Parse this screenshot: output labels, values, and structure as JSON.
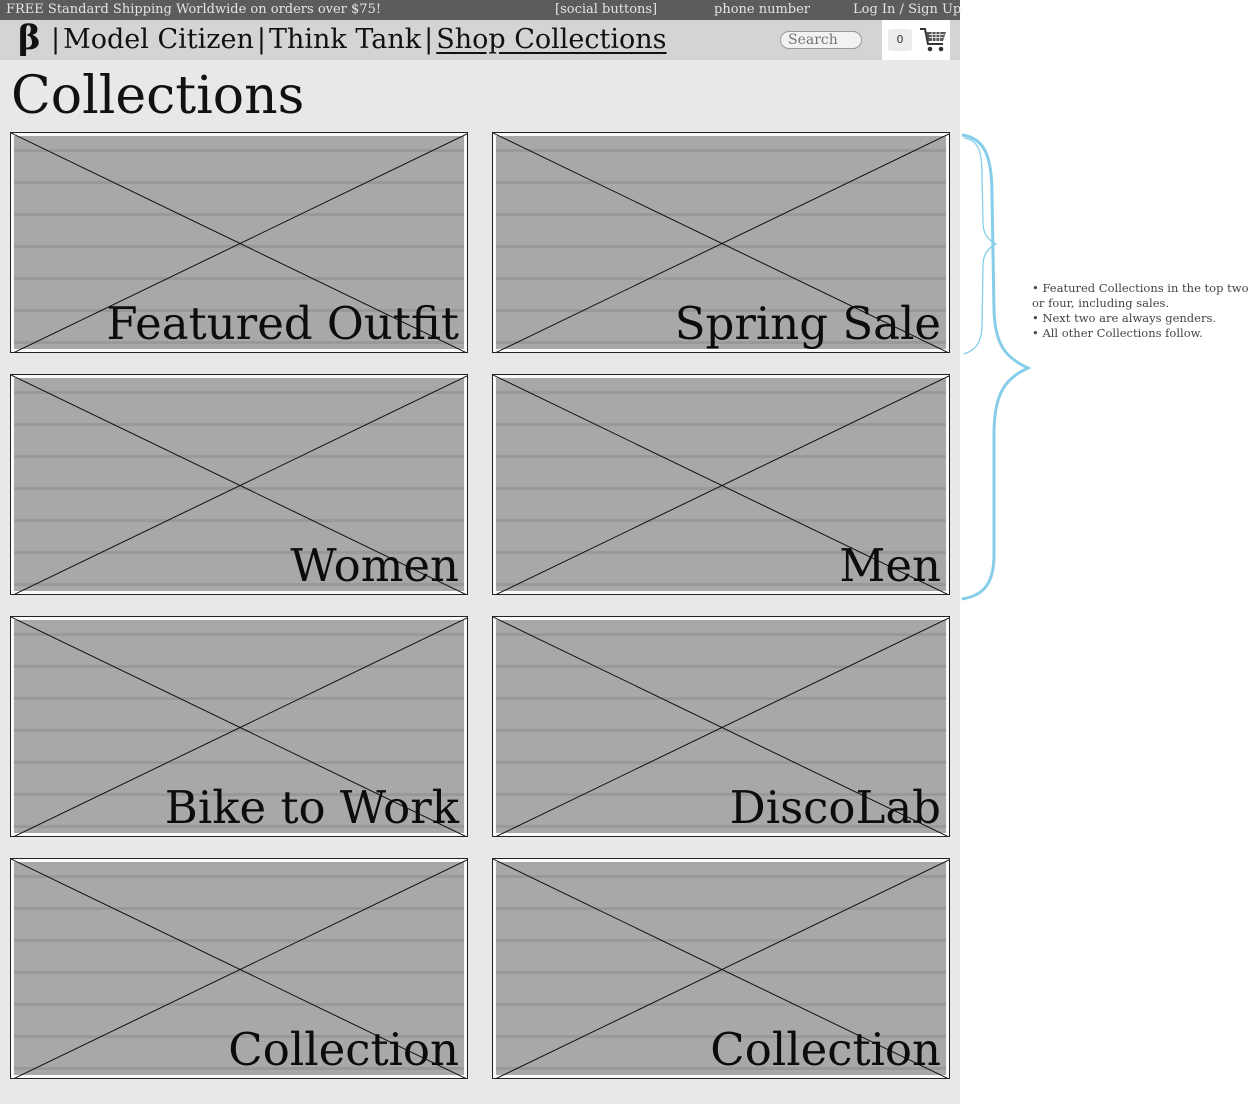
{
  "topbar": {
    "promo": "FREE Standard Shipping Worldwide on orders over $75!",
    "social": "[social buttons]",
    "phone": "phone number",
    "auth": "Log In / Sign Up"
  },
  "nav": {
    "logo": "β",
    "separator": "|",
    "links": [
      {
        "label": "Model Citizen",
        "active": false
      },
      {
        "label": "Think Tank",
        "active": false
      },
      {
        "label": "Shop Collections",
        "active": true
      }
    ],
    "search_placeholder": "Search",
    "cart_count": "0"
  },
  "page": {
    "title": "Collections"
  },
  "collections": [
    {
      "label": "Featured Outfit"
    },
    {
      "label": "Spring Sale"
    },
    {
      "label": "Women"
    },
    {
      "label": "Men"
    },
    {
      "label": "Bike to Work"
    },
    {
      "label": "DiscoLab"
    },
    {
      "label": "Collection"
    },
    {
      "label": "Collection"
    }
  ],
  "annotation": {
    "notes": [
      "• Featured Collections in the top two or four, including sales.",
      "• Next two are always genders.",
      "• All other Collections follow."
    ],
    "brace_color": "#86cdea"
  }
}
